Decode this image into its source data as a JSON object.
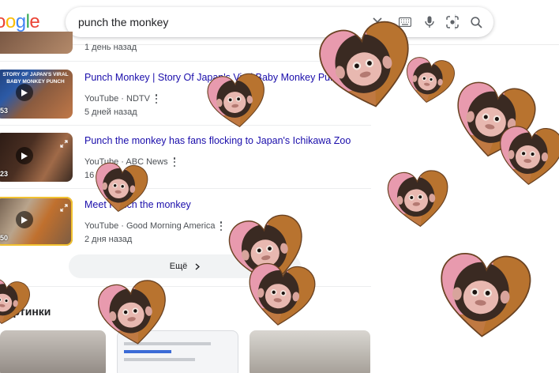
{
  "header": {
    "logo_text": "oogle",
    "search_query": "punch the monkey"
  },
  "previous_result": {
    "date": "1 день назад"
  },
  "results": [
    {
      "title": "Punch Monkey | Story Of Japan's Viral Baby Monkey Punch",
      "source": "YouTube · NDTV",
      "date": "5 дней назад",
      "duration": "53",
      "thumb_caption": "STORY OF JAPAN'S VIRAL BABY MONKEY PUNCH"
    },
    {
      "title": "Punch the monkey has fans flocking to Japan's Ichikawa Zoo",
      "source": "YouTube · ABC News",
      "date": "16 часов назад",
      "duration": "23",
      "thumb_caption": ""
    },
    {
      "title": "Meet Punch the monkey",
      "source": "YouTube · Good Morning America",
      "date": "2 дня назад",
      "duration": "50",
      "thumb_caption": ""
    }
  ],
  "more_button": {
    "label": "Ещё"
  },
  "images_section": {
    "heading": "Картинки"
  },
  "colors": {
    "link": "#1a0dab",
    "secondary_text": "#4d5156",
    "heart_pink": "#e89aae",
    "heart_brown": "#b8732f",
    "monkey_fur": "#3a2a22"
  }
}
